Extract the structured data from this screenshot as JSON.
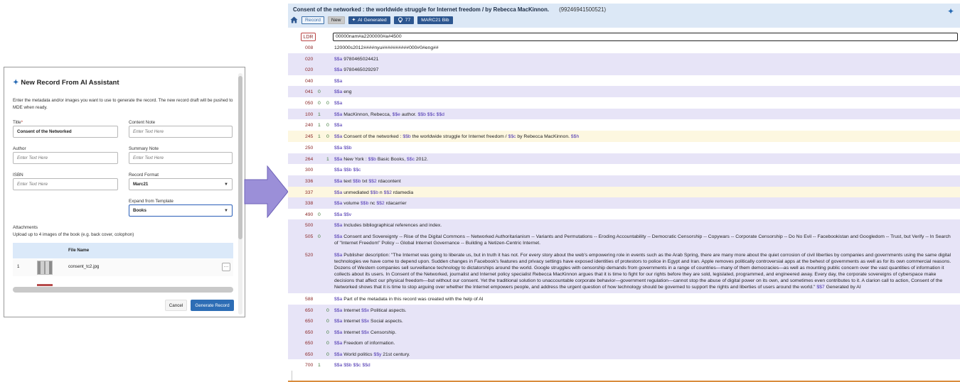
{
  "dialog": {
    "title": "New Record From AI Assistant",
    "icon": "sparkle-icon",
    "description": "Enter the metadata and/or images you want to use to generate the record. The new record draft will be pushed to MDE when ready.",
    "title_label": "Title",
    "title_value": "Consent of the Networked",
    "content_note_label": "Content Note",
    "content_note_placeholder": "Enter Text Here",
    "author_label": "Author",
    "author_placeholder": "Enter Text Here",
    "summary_note_label": "Summary Note",
    "summary_note_placeholder": "Enter Text Here",
    "isbn_label": "ISBN",
    "isbn_placeholder": "Enter Text Here",
    "record_format_label": "Record Format",
    "record_format_value": "Marc21",
    "template_label": "Expand from Template",
    "template_value": "Books",
    "attachments_label": "Attachments",
    "attachments_sub": "Upload up to 4 images of the book (e.g. back cover, colophon)",
    "file_name_header": "File Name",
    "files": [
      {
        "index": "1",
        "name": "consent_tc2.jpg",
        "more": "…"
      }
    ],
    "cancel_label": "Cancel",
    "generate_label": "Generate Record"
  },
  "editor": {
    "title": "Consent of the networked : the worldwide struggle for Internet freedom / by Rebecca MacKinnon.",
    "mms_id": "(99246941500521)",
    "tabs": {
      "record": "Record",
      "new": "New",
      "ai": "AI Generated",
      "count": "77",
      "bib": "MARC21 Bib"
    },
    "ldr_label": "LDR",
    "ldr_value": "00000nam#a2200000#a#4500",
    "rows": [
      {
        "tag": "008",
        "i1": "",
        "i2": "",
        "bg": "white",
        "content": "120000s2012####nyu##########000#0#eng##"
      },
      {
        "tag": "020",
        "i1": "",
        "i2": "",
        "bg": "lav",
        "content": "$$a 9780465024421"
      },
      {
        "tag": "020",
        "i1": "",
        "i2": "",
        "bg": "lav",
        "content": "$$a 9780465029297"
      },
      {
        "tag": "040",
        "i1": "",
        "i2": "",
        "bg": "white",
        "content": "$$a"
      },
      {
        "tag": "041",
        "i1": "0",
        "i2": "",
        "bg": "lav",
        "content": "$$a eng"
      },
      {
        "tag": "050",
        "i1": "0",
        "i2": "0",
        "bg": "white",
        "content": "$$a"
      },
      {
        "tag": "100",
        "i1": "1",
        "i2": "",
        "bg": "lav",
        "content": "$$a MacKinnon, Rebecca, $$e author. $$b  $$c  $$d"
      },
      {
        "tag": "240",
        "i1": "1",
        "i2": "0",
        "bg": "white",
        "content": "$$a"
      },
      {
        "tag": "245",
        "i1": "1",
        "i2": "0",
        "bg": "yellow",
        "content": "$$a Consent of the networked : $$b the worldwide struggle for Internet freedom / $$c by Rebecca MacKinnon. $$h"
      },
      {
        "tag": "250",
        "i1": "",
        "i2": "",
        "bg": "white",
        "content": "$$a  $$b"
      },
      {
        "tag": "264",
        "i1": "",
        "i2": "1",
        "bg": "lav",
        "content": "$$a New York : $$b Basic Books, $$c 2012."
      },
      {
        "tag": "300",
        "i1": "",
        "i2": "",
        "bg": "white",
        "content": "$$a  $$b  $$c"
      },
      {
        "tag": "336",
        "i1": "",
        "i2": "",
        "bg": "lav",
        "content": "$$a text $$b txt $$2 rdacontent"
      },
      {
        "tag": "337",
        "i1": "",
        "i2": "",
        "bg": "yellow",
        "content": "$$a unmediated $$b n $$2 rdamedia"
      },
      {
        "tag": "338",
        "i1": "",
        "i2": "",
        "bg": "lav",
        "content": "$$a volume $$b nc $$2 rdacarrier"
      },
      {
        "tag": "490",
        "i1": "0",
        "i2": "",
        "bg": "white",
        "content": "$$a  $$v"
      },
      {
        "tag": "500",
        "i1": "",
        "i2": "",
        "bg": "lav",
        "content": "$$a Includes bibliographical references and index."
      },
      {
        "tag": "505",
        "i1": "0",
        "i2": "",
        "bg": "lav",
        "tall": true,
        "content": "$$a Consent and Sovereignty -- Rise of the Digital Commons -- Networked Authoritarianism -- Variants and Permutations -- Eroding Accountability -- Democratic Censorship -- Copywars -- Corporate Censorship -- Do No Evil -- Facebookistan and Googledom -- Trust, but Verify -- In Search of \"Internet Freedom\" Policy -- Global Internet Governance -- Building a Netizen-Centric Internet."
      },
      {
        "tag": "520",
        "i1": "",
        "i2": "",
        "bg": "lav",
        "tall": true,
        "content": "$$a Publisher description: \"The Internet was going to liberate us, but in truth it has not. For every story about the web's empowering role in events such as the Arab Spring, there are many more about the quiet corrosion of civil liberties by companies and governments using the same digital technologies we have come to depend upon. Sudden changes in Facebook's features and privacy settings have exposed identities of protestors to police in Egypt and Iran. Apple removes politically controversial apps at the behest of governments as well as for its own commercial reasons. Dozens of Western companies sell surveillance technology to dictatorships around the world. Google struggles with censorship demands from governments in a range of countries—many of them democracies—as well as mounting public concern over the vast quantities of information it collects about its users. In Consent of the Networked, journalist and Internet policy specialist Rebecca MacKinnon argues that it is time to fight for our rights before they are sold, legislated, programmed, and engineered away. Every day, the corporate sovereigns of cyberspace make decisions that affect our physical freedom—but without our consent. Yet the traditional solution to unaccountable corporate behavior—government regulation—cannot stop the abuse of digital power on its own, and sometimes even contributes to it. A clarion call to action, Consent of the Networked shows that it is time to stop arguing over whether the Internet empowers people, and address the urgent question of how technology should be governed to support the rights and liberties of users around the world.\" $$7 Generated by AI"
      },
      {
        "tag": "588",
        "i1": "",
        "i2": "",
        "bg": "white",
        "content": "$$a Part of the metadata in this record was created with the help of AI"
      },
      {
        "tag": "650",
        "i1": "",
        "i2": "0",
        "bg": "lav",
        "content": "$$a Internet $$x Political aspects."
      },
      {
        "tag": "650",
        "i1": "",
        "i2": "0",
        "bg": "lav",
        "content": "$$a Internet $$x Social aspects."
      },
      {
        "tag": "650",
        "i1": "",
        "i2": "0",
        "bg": "lav",
        "content": "$$a Internet $$x Censorship."
      },
      {
        "tag": "650",
        "i1": "",
        "i2": "0",
        "bg": "lav",
        "content": "$$a Freedom of information."
      },
      {
        "tag": "650",
        "i1": "",
        "i2": "0",
        "bg": "lav",
        "content": "$$a World politics $$y 21st century."
      },
      {
        "tag": "700",
        "i1": "1",
        "i2": "",
        "bg": "white",
        "content": "$$a  $$b  $$c  $$d"
      }
    ]
  },
  "colors": {
    "accent": "#2d6db5",
    "row_lavender": "#e7e4f7",
    "row_yellow": "#fdf7e0",
    "subfield": "#4a32b0",
    "tag": "#8b2a2a",
    "arrow": "#9b8fd8"
  }
}
